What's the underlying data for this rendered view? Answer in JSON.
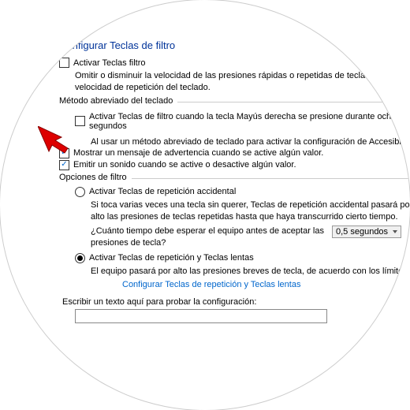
{
  "heading": "Configurar Teclas de filtro",
  "activate": {
    "label": "Activar Teclas filtro",
    "desc": "Omitir o disminuir la velocidad de las presiones rápidas o repetidas de tecla y ajustar la velocidad de repetición del teclado."
  },
  "shortcut": {
    "legend": "Método abreviado del teclado",
    "enable_label": "Activar Teclas de filtro cuando la tecla Mayús derecha se presione durante ocho segundos",
    "note": "Al usar un método abreviado de teclado para activar la configuración de Accesibilidad:",
    "warn_label": "Mostrar un mensaje de advertencia cuando se active algún valor.",
    "sound_label": "Emitir un sonido cuando se active o desactive algún valor."
  },
  "filter": {
    "legend": "Opciones de filtro",
    "opt1_label": "Activar Teclas de repetición accidental",
    "opt1_desc": "Si toca varias veces una tecla sin querer, Teclas de repetición accidental pasará por alto las presiones de teclas repetidas hasta que haya transcurrido cierto tiempo.",
    "opt1_question": "¿Cuánto tiempo debe esperar el equipo antes de aceptar las presiones de tecla?",
    "opt1_value": "0,5 segundos",
    "opt2_label": "Activar Teclas de repetición y Teclas lentas",
    "opt2_desc": "El equipo pasará por alto las presiones breves de tecla, de acuerdo con los límites",
    "opt2_link": "Configurar Teclas de repetición y Teclas lentas"
  },
  "test": {
    "label": "Escribir un texto aquí para probar la configuración:",
    "value": ""
  }
}
